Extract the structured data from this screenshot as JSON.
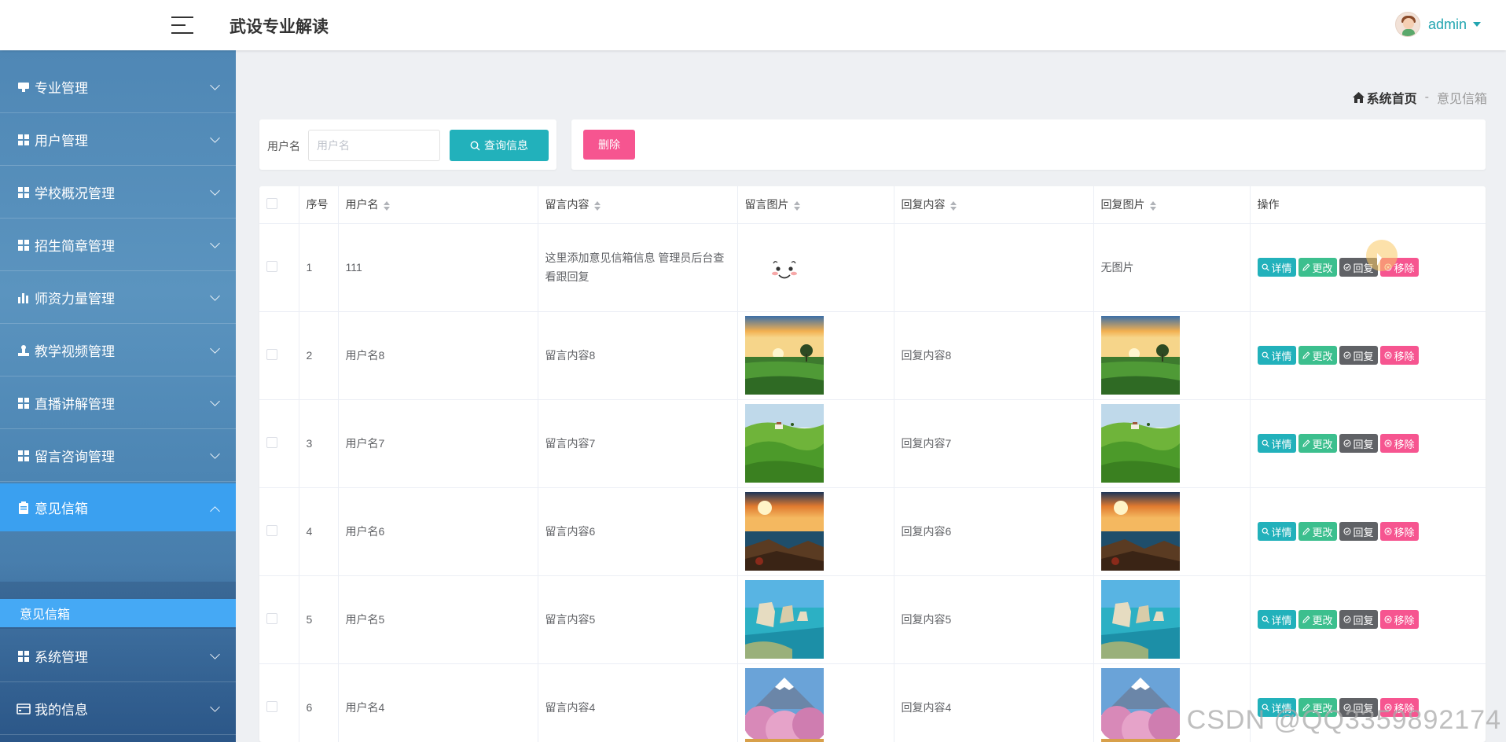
{
  "header": {
    "app_title": "武设专业解读",
    "user_name": "admin"
  },
  "sidebar": {
    "items": [
      {
        "label": "专业管理",
        "icon": "monitor-icon"
      },
      {
        "label": "用户管理",
        "icon": "grid-icon"
      },
      {
        "label": "学校概况管理",
        "icon": "grid-icon"
      },
      {
        "label": "招生简章管理",
        "icon": "grid-icon"
      },
      {
        "label": "师资力量管理",
        "icon": "bar-chart-icon"
      },
      {
        "label": "教学视频管理",
        "icon": "stamp-icon"
      },
      {
        "label": "直播讲解管理",
        "icon": "grid-icon"
      },
      {
        "label": "留言咨询管理",
        "icon": "grid-icon"
      },
      {
        "label": "意见信箱",
        "icon": "clipboard-icon",
        "active": true
      },
      {
        "label": "系统管理",
        "icon": "grid-icon"
      },
      {
        "label": "我的信息",
        "icon": "wallet-icon"
      }
    ],
    "sub_item": "意见信箱"
  },
  "breadcrumb": {
    "home": "系统首页",
    "separator": "-",
    "current": "意见信箱"
  },
  "search": {
    "label": "用户名",
    "placeholder": "用户名",
    "value": "",
    "button": "查询信息"
  },
  "actions": {
    "delete": "删除"
  },
  "table": {
    "headers": {
      "index": "序号",
      "username": "用户名",
      "content": "留言内容",
      "image": "留言图片",
      "reply": "回复内容",
      "reply_image": "回复图片",
      "ops": "操作"
    },
    "ops_labels": {
      "detail": "详情",
      "edit": "更改",
      "reply": "回复",
      "remove": "移除"
    },
    "rows": [
      {
        "index": "1",
        "username": "111",
        "content": "这里添加意见信箱信息 管理员后台查看跟回复",
        "image": "smiley",
        "reply": "",
        "reply_image_text": "无图片",
        "reply_image": ""
      },
      {
        "index": "2",
        "username": "用户名8",
        "content": "留言内容8",
        "image": "field-sunset",
        "reply": "回复内容8",
        "reply_image_text": "",
        "reply_image": "field-sunset"
      },
      {
        "index": "3",
        "username": "用户名7",
        "content": "留言内容7",
        "image": "green-hills",
        "reply": "回复内容7",
        "reply_image_text": "",
        "reply_image": "green-hills"
      },
      {
        "index": "4",
        "username": "用户名6",
        "content": "留言内容6",
        "image": "sea-sunset",
        "reply": "回复内容6",
        "reply_image_text": "",
        "reply_image": "sea-sunset"
      },
      {
        "index": "5",
        "username": "用户名5",
        "content": "留言内容5",
        "image": "sea-stacks",
        "reply": "回复内容5",
        "reply_image_text": "",
        "reply_image": "sea-stacks"
      },
      {
        "index": "6",
        "username": "用户名4",
        "content": "留言内容4",
        "image": "fuji-blossom",
        "reply": "回复内容4",
        "reply_image_text": "",
        "reply_image": "fuji-blossom"
      }
    ]
  },
  "watermark": "CSDN @QQ3359892174"
}
